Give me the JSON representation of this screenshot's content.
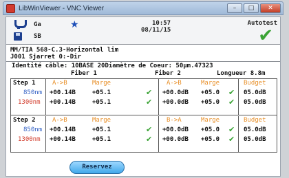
{
  "window": {
    "title": "LibWinViewer - VNC Viewer",
    "min": "–",
    "max": "□",
    "close": "✕"
  },
  "header": {
    "ga": "Ga",
    "sb": "SB",
    "time": "10:57",
    "date": "08/11/15",
    "mode": "Autotest",
    "pass_mark": "✔"
  },
  "path": {
    "line1": "MM/TIA 568-C.3-Horizontal lim",
    "line2": "J001 Sjarret 0:-Dir"
  },
  "ident": {
    "text": "Identité câble: 10BASE 20Diamètre de Coeur: 50µm.47323",
    "fiber1": "Fiber 1",
    "fiber2": "Fiber 2",
    "length": "Longueur 8.8m"
  },
  "table": {
    "steps": [
      {
        "label": "Step 1",
        "wavelengths": [
          "850nm",
          "1300nm"
        ],
        "f1": {
          "h1": "A->B",
          "h2": "Marge",
          "r1": [
            "+00.14B",
            "+05.1"
          ],
          "r2": [
            "+00.14B",
            "+05.1"
          ]
        },
        "f2": {
          "h1": "A->B",
          "h2": "Marge",
          "r1": [
            "+00.0dB",
            "+05.0"
          ],
          "r2": [
            "+00.0dB",
            "+05.0"
          ]
        },
        "budget": {
          "h": "Budget",
          "r1": "05.0dB",
          "r2": "05.0dB"
        }
      },
      {
        "label": "Step 2",
        "wavelengths": [
          "850nm",
          "1300nm"
        ],
        "f1": {
          "h1": "A->B",
          "h2": "Marge",
          "r1": [
            "+00.14B",
            "+05.1"
          ],
          "r2": [
            "+00.14B",
            "+05.1"
          ]
        },
        "f2": {
          "h1": "B->A",
          "h2": "Marge",
          "r1": [
            "+00.0dB",
            "+05.0"
          ],
          "r2": [
            "+00.0dB",
            "+05.0"
          ]
        },
        "budget": {
          "h": "Budget",
          "r1": "05.0dB",
          "r2": "05.0dB"
        }
      }
    ],
    "check": "✔"
  },
  "buttons": {
    "reserve": "Reservez"
  }
}
